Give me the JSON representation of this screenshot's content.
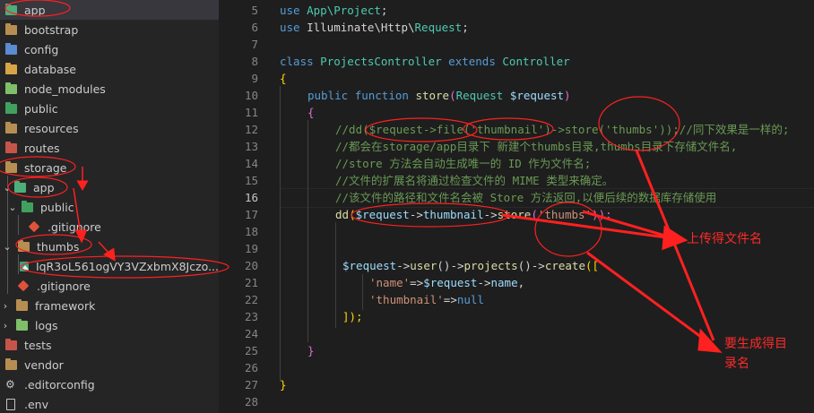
{
  "explorer": {
    "items": [
      {
        "label": "app",
        "icon": "folder-app-icon"
      },
      {
        "label": "bootstrap",
        "icon": "folder-icon"
      },
      {
        "label": "config",
        "icon": "folder-config-icon"
      },
      {
        "label": "database",
        "icon": "folder-database-icon"
      },
      {
        "label": "node_modules",
        "icon": "folder-node-icon"
      },
      {
        "label": "public",
        "icon": "folder-public-icon"
      },
      {
        "label": "resources",
        "icon": "folder-icon"
      },
      {
        "label": "routes",
        "icon": "folder-routes-icon"
      },
      {
        "label": "storage",
        "icon": "folder-open-icon"
      },
      {
        "label": "app",
        "icon": "folder-app-icon"
      },
      {
        "label": "public",
        "icon": "folder-public-icon"
      },
      {
        "label": ".gitignore",
        "icon": "git-icon"
      },
      {
        "label": "thumbs",
        "icon": "folder-open-icon"
      },
      {
        "label": "IqR3oL561ogVY3VZxbmX8Jczo...",
        "icon": "image-file-icon"
      },
      {
        "label": ".gitignore",
        "icon": "git-icon"
      },
      {
        "label": "framework",
        "icon": "folder-icon"
      },
      {
        "label": "logs",
        "icon": "folder-logs-icon"
      },
      {
        "label": "tests",
        "icon": "folder-tests-icon"
      },
      {
        "label": "vendor",
        "icon": "folder-icon"
      },
      {
        "label": ".editorconfig",
        "icon": "settings-file-icon"
      },
      {
        "label": ".env",
        "icon": "file-icon"
      }
    ]
  },
  "editor": {
    "active_line": 16,
    "line_numbers": [
      "5",
      "6",
      "7",
      "8",
      "9",
      "10",
      "11",
      "12",
      "13",
      "14",
      "15",
      "16",
      "17",
      "18",
      "19",
      "20",
      "21",
      "22",
      "23",
      "24",
      "25",
      "26",
      "27",
      "28"
    ],
    "code": {
      "l5_kw": "use",
      "l5_ns": "App\\",
      "l5_cls": "Project",
      "l5_end": ";",
      "l6_kw": "use",
      "l6_ns": "Illuminate\\Http\\",
      "l6_cls": "Request",
      "l6_end": ";",
      "l8_kw1": "class",
      "l8_cls": "ProjectsController",
      "l8_kw2": "extends",
      "l8_cls2": "Controller",
      "l9": "{",
      "l10_kw1": "public",
      "l10_kw2": "function",
      "l10_fn": "store",
      "l10_p1": "(",
      "l10_cls": "Request",
      "l10_var": "$request",
      "l10_p2": ")",
      "l11": "{",
      "l12": "//dd($request->file('thumbnail')->store('thumbs'));//同下效果是一样的;",
      "l13": "//都会在storage/app目录下 新建个thumbs目录,thumbs目录下存储文件名,",
      "l14": "//store 方法会自动生成唯一的 ID 作为文件名;",
      "l15": "//文件的扩展名将通过检查文件的 MIME 类型来确定。",
      "l16": "//该文件的路径和文件名会被 Store 方法返回,以便后续的数据库存储使用",
      "l17_fn": "dd",
      "l17_p1": "(",
      "l17_var": "$request",
      "l17_arrow": "->",
      "l17_prop": "thumbnail",
      "l17_arrow2": "->",
      "l17_fn2": "store",
      "l17_p2": "(",
      "l17_str": "'thumbs'",
      "l17_end": "));",
      "l20_var": "$request",
      "l20_a1": "->",
      "l20_fn1": "user",
      "l20_p1": "()->",
      "l20_fn2": "projects",
      "l20_p2": "()->",
      "l20_fn3": "create",
      "l20_p3": "([",
      "l21_str": "'name'",
      "l21_op": "=>",
      "l21_var": "$request",
      "l21_a": "->",
      "l21_prop": "name",
      "l21_end": ",",
      "l22_str": "'thumbnail'",
      "l22_op": "=>",
      "l22_kw": "null",
      "l23": "]);",
      "l25": "}",
      "l27": "}"
    }
  },
  "annotations": {
    "upload_label": "上传得文件名",
    "dir_label_1": "要生成得目",
    "dir_label_2": "录名",
    "color": "#ff2020"
  }
}
